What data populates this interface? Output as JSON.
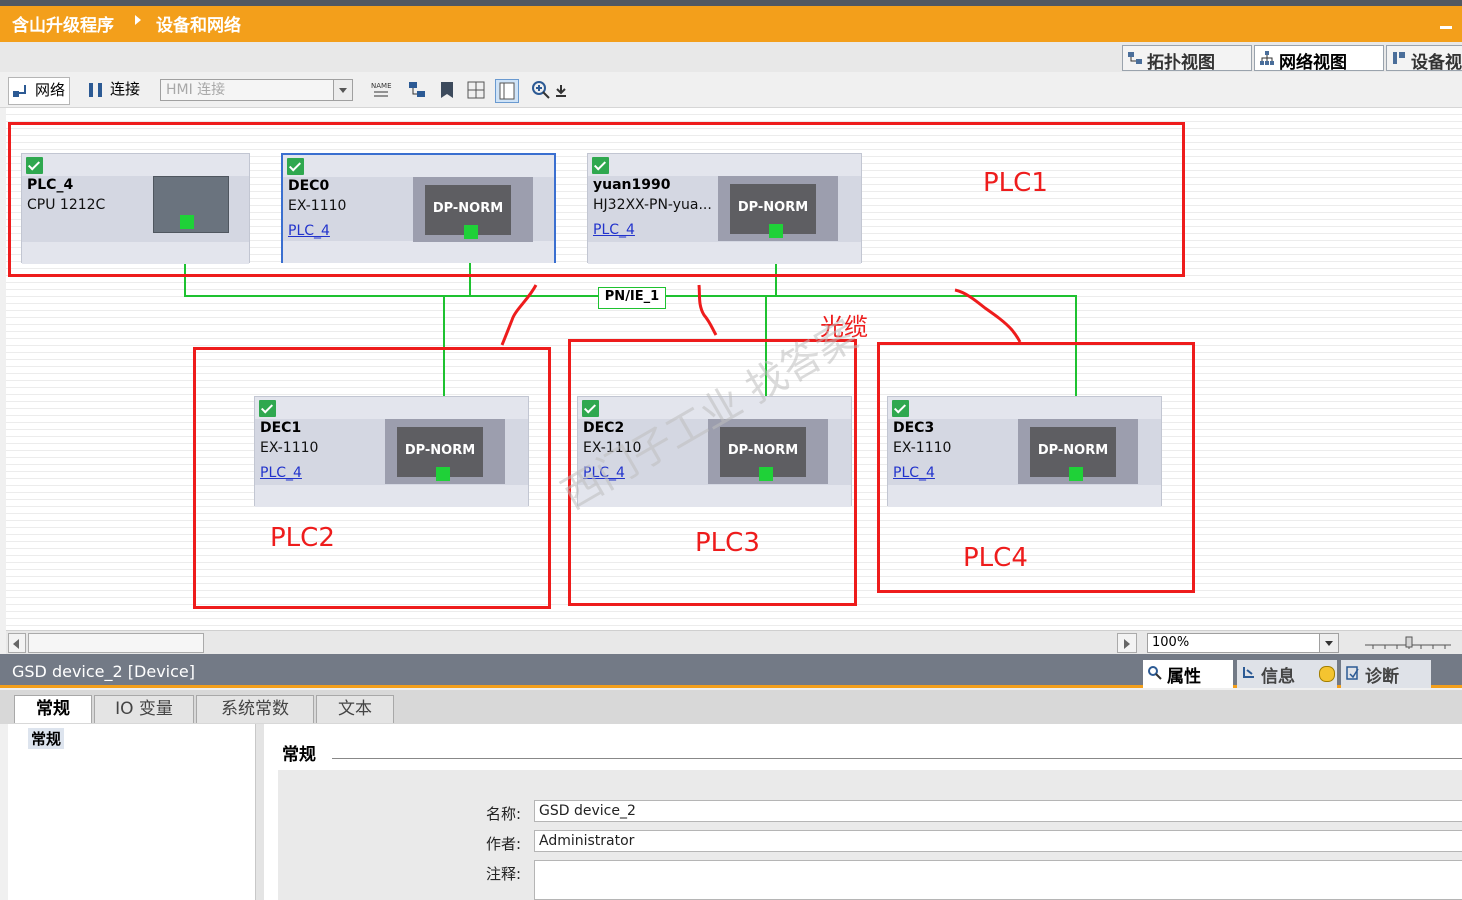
{
  "title_bar": {
    "project": "含山升级程序",
    "section": "设备和网络"
  },
  "view_tabs": [
    {
      "label": "拓扑视图"
    },
    {
      "label": "网络视图"
    },
    {
      "label": "设备视"
    }
  ],
  "toolbar": {
    "network_label": "网络",
    "connection_label": "连接",
    "hmi_connection": "HMI 连接"
  },
  "devices": {
    "plc4": {
      "name": "PLC_4",
      "type": "CPU 1212C"
    },
    "dec0": {
      "name": "DEC0",
      "type": "EX-1110",
      "link": "PLC_4",
      "module": "DP-NORM"
    },
    "yuan": {
      "name": "yuan1990",
      "type": "HJ32XX-PN-yua...",
      "link": "PLC_4",
      "module": "DP-NORM"
    },
    "dec1": {
      "name": "DEC1",
      "type": "EX-1110",
      "link": "PLC_4",
      "module": "DP-NORM"
    },
    "dec2": {
      "name": "DEC2",
      "type": "EX-1110",
      "link": "PLC_4",
      "module": "DP-NORM"
    },
    "dec3": {
      "name": "DEC3",
      "type": "EX-1110",
      "link": "PLC_4",
      "module": "DP-NORM"
    }
  },
  "network_label": "PN/IE_1",
  "annotations": {
    "plc1": "PLC1",
    "plc2": "PLC2",
    "plc3": "PLC3",
    "plc4": "PLC4",
    "cable": "光缆"
  },
  "watermark": "西门子工业 找答案",
  "zoom": "100%",
  "properties": {
    "title": "GSD device_2 [Device]",
    "tabs": [
      {
        "label": "属性"
      },
      {
        "label": "信息"
      },
      {
        "label": "诊断"
      }
    ],
    "subtabs": [
      {
        "label": "常规"
      },
      {
        "label": "IO 变量"
      },
      {
        "label": "系统常数"
      },
      {
        "label": "文本"
      }
    ],
    "nav_item": "常规",
    "section": "常规",
    "fields": {
      "name_label": "名称:",
      "name_value": "GSD device_2",
      "author_label": "作者:",
      "author_value": "Administrator",
      "comment_label": "注释:",
      "comment_value": ""
    }
  },
  "colors": {
    "accent": "#f39f1b",
    "network_line": "#1ec230",
    "annotation_red": "#ee1c1c"
  }
}
